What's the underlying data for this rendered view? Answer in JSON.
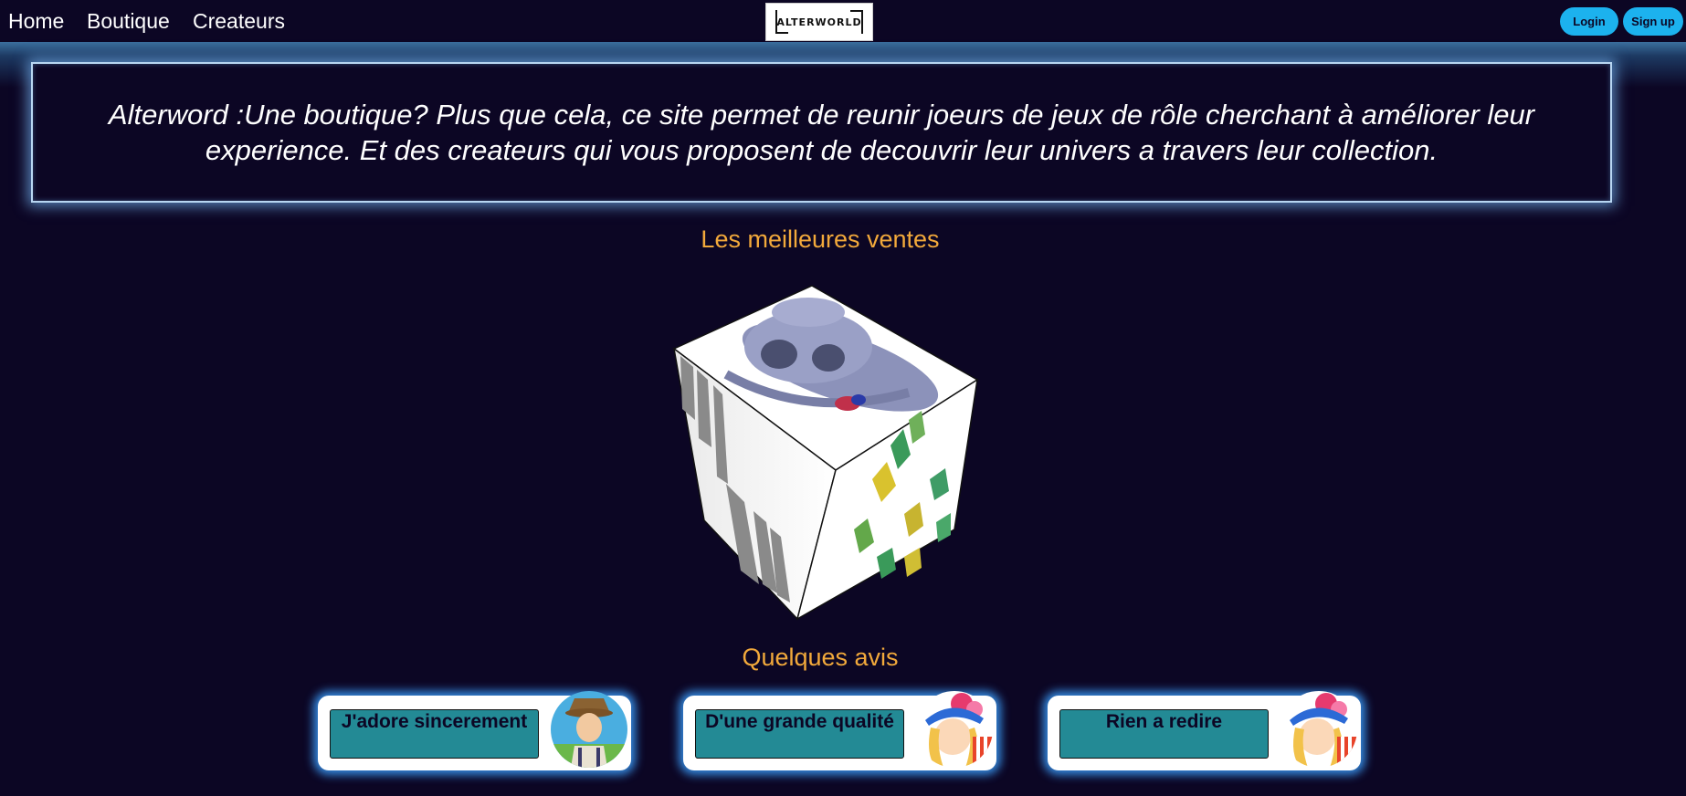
{
  "nav": {
    "home": "Home",
    "boutique": "Boutique",
    "createurs": "Createurs"
  },
  "logo": {
    "text": "ALTERWORLD"
  },
  "auth": {
    "login": "Login",
    "signup": "Sign up"
  },
  "intro": {
    "text": "Alterword :Une boutique? Plus que cela, ce site permet de reunir joeurs de jeux de rôle cherchant à améliorer leur experience. Et des createurs qui vous proposent de decouvrir leur univers a travers leur collection."
  },
  "bestsellers": {
    "title": "Les meilleures ventes"
  },
  "reviews": {
    "title": "Quelques avis",
    "items": [
      {
        "text": "J'adore sincerement"
      },
      {
        "text": "D'une grande qualité"
      },
      {
        "text": "Rien a redire"
      }
    ]
  },
  "colors": {
    "background": "#0c0624",
    "accent_orange": "#f2a93b",
    "button_blue": "#1cb2ee",
    "review_box": "#238a95"
  }
}
